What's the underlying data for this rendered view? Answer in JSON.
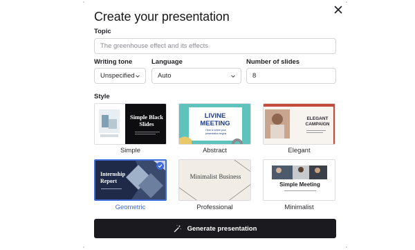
{
  "dialog": {
    "title": "Create your presentation",
    "close_icon": "close-icon"
  },
  "topic": {
    "label": "Topic",
    "value": "The greenhouse effect and its effects"
  },
  "writing_tone": {
    "label": "Writing tone",
    "value": "Unspecified"
  },
  "language": {
    "label": "Language",
    "value": "Auto"
  },
  "slides": {
    "label": "Number of slides",
    "value": "8"
  },
  "style": {
    "label": "Style",
    "selected": "Geometric",
    "accent": "#3f6ad8",
    "options": [
      {
        "name": "Simple",
        "thumb_title": "Simple Black Slides"
      },
      {
        "name": "Abstract",
        "thumb_title": "LIVINE MEETING",
        "thumb_sub": "Here is where your presentation begins"
      },
      {
        "name": "Elegant",
        "thumb_title": "ELEGANT CAMPAIGN"
      },
      {
        "name": "Geometric",
        "thumb_title": "Internship Report"
      },
      {
        "name": "Professional",
        "thumb_title": "Minimalist Business"
      },
      {
        "name": "Minimalist",
        "thumb_title": "Simple Meeting"
      }
    ]
  },
  "generate": {
    "label": "Generate presentation",
    "icon": "magic-wand-icon"
  }
}
